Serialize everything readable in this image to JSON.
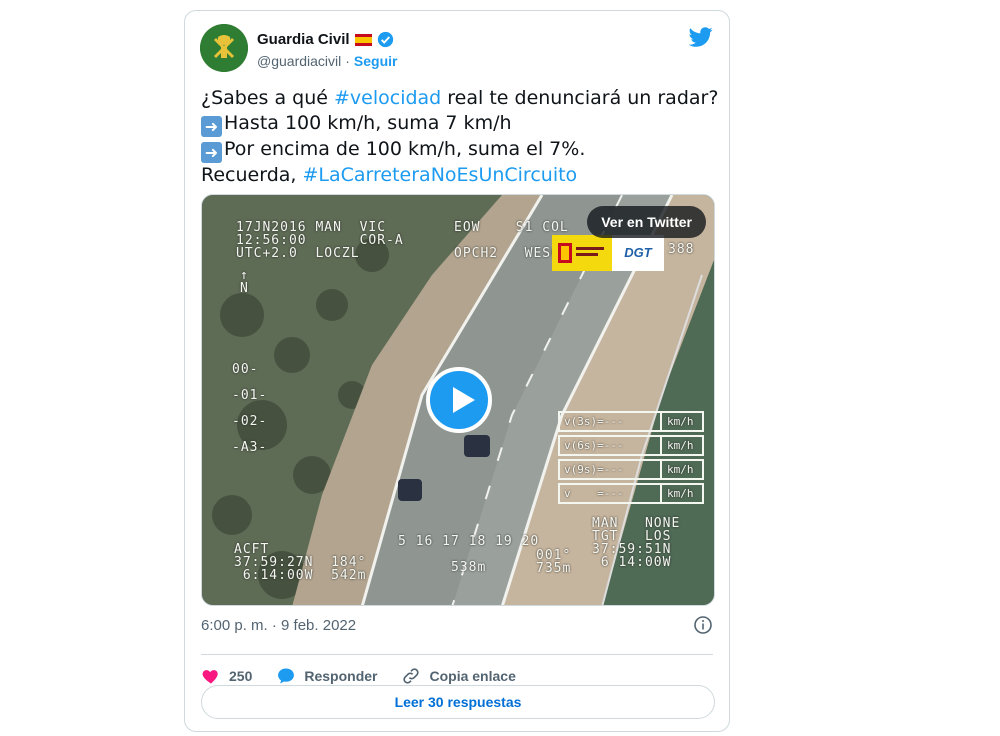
{
  "account": {
    "name": "Guardia Civil",
    "handle": "@guardiacivil",
    "separator": "·",
    "follow_label": "Seguir"
  },
  "tweet": {
    "line1_pre": "¿Sabes a qué ",
    "line1_hash": "#velocidad",
    "line1_post": " real te denunciará un radar?",
    "line2": "Hasta 100 km/h, suma 7 km/h",
    "line3": "Por encima de 100 km/h, suma el 7%.",
    "line4_pre": "Recuerda, ",
    "line4_hash": "#LaCarreteraNoEsUnCircuito"
  },
  "media": {
    "view_button": "Ver en Twitter",
    "osd_top_left": "17JN2016 MAN  VIC\n12:56:00      COR-A\nUTC+2.0  LOCZL",
    "osd_top_mid": "EOW    S1 COL\n\nOPCH2   WESCAM",
    "osd_top_right": "388",
    "osd_north": "↑\nN",
    "osd_scale": "00-\n\n-01-\n\n-02-\n\n-A3-",
    "osd_bottom_left": "ACFT\n37:59:27N  184°\n 6:14:00W  542m",
    "osd_bottom_mid": "5 16 17 18 19 20\n\n      538m",
    "osd_bottom_right": "MAN   NONE\nTGT   LOS\n37:59:51N\n 6 14:00W",
    "osd_bottom_right2": "001°\n735m",
    "speed_rows": [
      {
        "left": "v(3s)=---",
        "right": "km/h"
      },
      {
        "left": "v(6s)=---",
        "right": "km/h"
      },
      {
        "left": "v(9s)=---",
        "right": "km/h"
      },
      {
        "left": "v    =---",
        "right": "km/h"
      }
    ],
    "logo_dgt": "DGT"
  },
  "meta": {
    "timestamp": "6:00 p. m. · 9 feb. 2022"
  },
  "actions": {
    "likes": "250",
    "reply": "Responder",
    "copy_link": "Copia enlace",
    "read_replies": "Leer 30 respuestas"
  },
  "icons": [
    "flag-spain-icon",
    "verified-badge-icon",
    "twitter-bird-icon",
    "play-icon",
    "info-icon",
    "heart-icon",
    "reply-icon",
    "link-icon"
  ],
  "colors": {
    "accent": "#1d9bf0",
    "heart": "#f91880",
    "text": "#0f1419",
    "muted": "#536471"
  }
}
